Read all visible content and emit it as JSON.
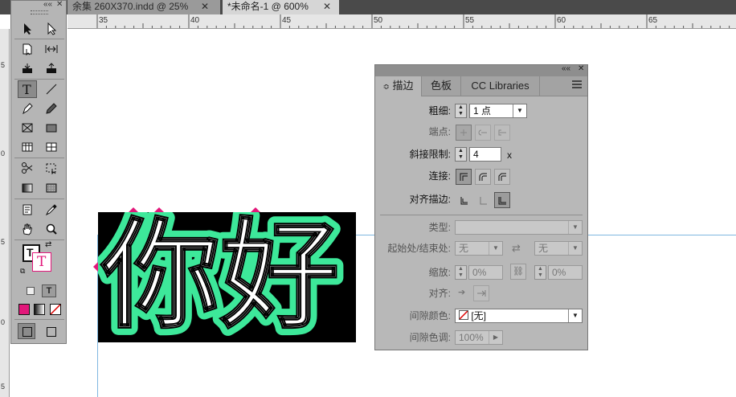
{
  "tabs": [
    {
      "label": "余集  260X370.indd @ 25%",
      "close": "✕"
    },
    {
      "label": "*未命名-1 @ 600%",
      "close": "✕"
    }
  ],
  "ruler": {
    "marks": [
      "35",
      "40",
      "45",
      "50",
      "55",
      "60",
      "65"
    ],
    "side_marks": [
      "5",
      "0",
      "5",
      "0",
      "5"
    ]
  },
  "canvas": {
    "text": "你好",
    "fill_color": "#ffffff",
    "stroke_color": "#3de89a",
    "frame_color": "#000000",
    "marker_color": "#e2177a"
  },
  "tools_panel": {
    "collapse": "««",
    "close": "✕",
    "tools": [
      "selection-arrow-icon",
      "direct-select-icon",
      "page-tool-icon",
      "gap-tool-icon",
      "content-collector-icon",
      "content-placer-icon",
      "type-tool-icon",
      "line-tool-icon",
      "pen-tool-icon",
      "pencil-tool-icon",
      "rect-frame-icon",
      "rectangle-tool-icon",
      "table-icon",
      "grid-icon",
      "scissors-icon",
      "free-transform-icon",
      "gradient-swatch-icon",
      "gradient-feather-icon",
      "note-tool-icon",
      "eyedropper-icon",
      "hand-tool-icon",
      "zoom-tool-icon"
    ],
    "fill_letter": "T",
    "fill_color": "#e2177a"
  },
  "stroke_panel": {
    "header": {
      "collapse": "««",
      "close": "✕"
    },
    "tabs": [
      {
        "label": "描边",
        "active": true,
        "prefix": "≎"
      },
      {
        "label": "色板",
        "active": false
      },
      {
        "label": "CC Libraries",
        "active": false
      }
    ],
    "weight": {
      "label": "粗细:",
      "value": "1 点"
    },
    "cap": {
      "label": "端点:"
    },
    "miter": {
      "label": "斜接限制:",
      "value": "4",
      "unit": "x"
    },
    "join": {
      "label": "连接:"
    },
    "align": {
      "label": "对齐描边:"
    },
    "type": {
      "label": "类型:",
      "value": ""
    },
    "start_end": {
      "label": "起始处/结束处:",
      "start": "无",
      "end": "无"
    },
    "scale": {
      "label": "缩放:",
      "start": "0%",
      "end": "0%"
    },
    "alignment": {
      "label": "对齐:"
    },
    "gap_color": {
      "label": "间隙颜色:",
      "value": "[无]"
    },
    "gap_tint": {
      "label": "间隙色调:",
      "value": "100%"
    }
  }
}
